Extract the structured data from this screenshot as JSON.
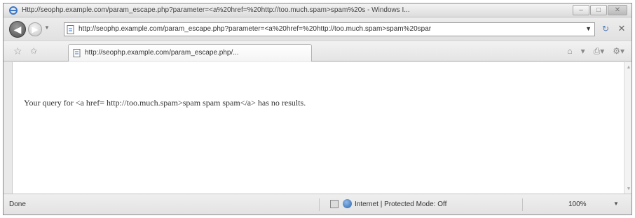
{
  "window": {
    "title": "Http://seophp.example.com/param_escape.php?parameter=<a%20href=%20http://too.much.spam>spam%20s - Windows I..."
  },
  "address_bar": {
    "url": "http://seophp.example.com/param_escape.php?parameter=<a%20href=%20http://too.much.spam>spam%20spar"
  },
  "tab": {
    "label": "http://seophp.example.com/param_escape.php/..."
  },
  "content": {
    "message": "Your query for <a href= http://too.much.spam>spam spam spam</a> has no results."
  },
  "status": {
    "left": "Done",
    "zone": "Internet | Protected Mode: Off",
    "zoom": "100%"
  },
  "icons": [
    "ie-icon",
    "back-arrow-icon",
    "forward-arrow-icon",
    "page-icon",
    "refresh-icon",
    "stop-icon",
    "favorites-star-icon",
    "add-favorites-icon",
    "home-icon",
    "feeds-icon",
    "print-icon",
    "tools-icon",
    "zone-icon",
    "zoom-icon"
  ]
}
